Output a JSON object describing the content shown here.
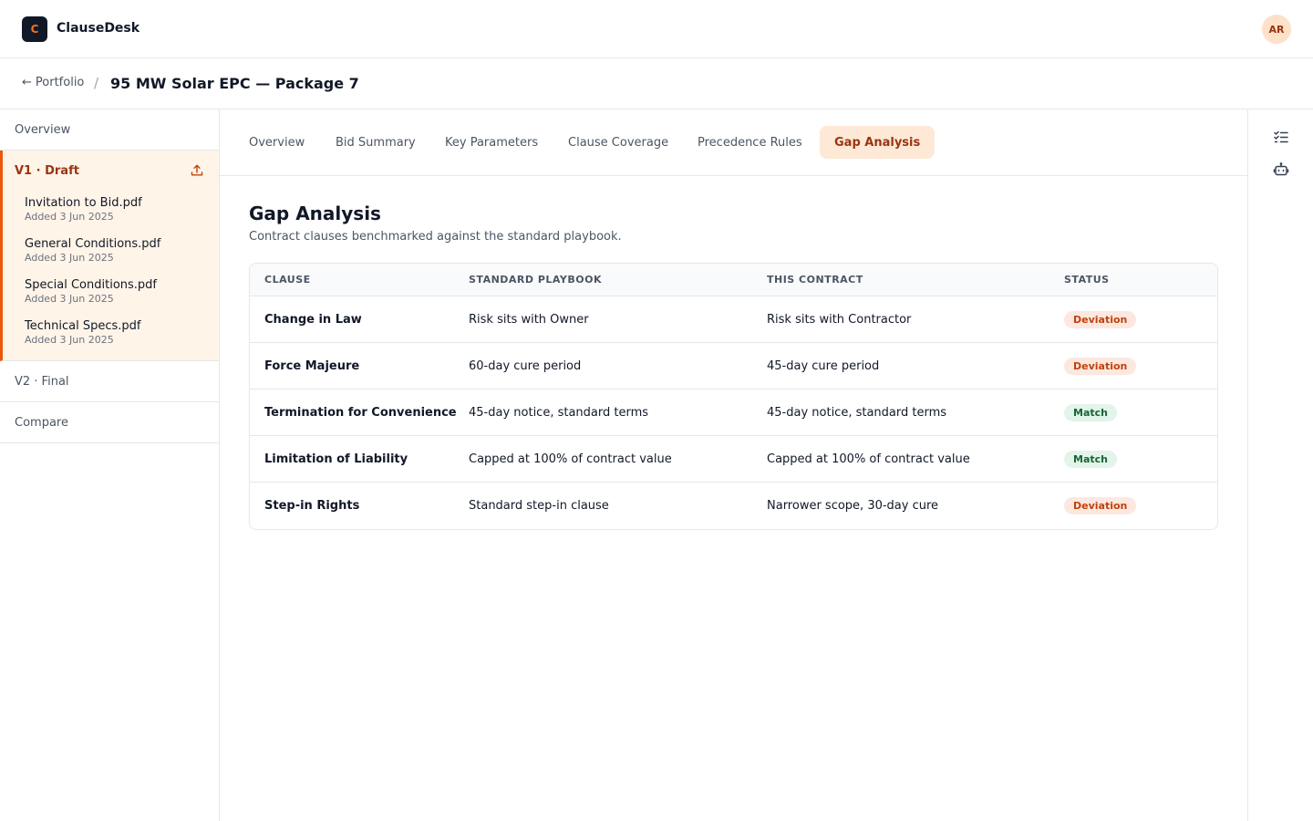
{
  "app": {
    "logo_letter": "C",
    "name": "ClauseDesk",
    "user_initials": "AR"
  },
  "breadcrumb": {
    "back_label": "Portfolio",
    "separator": "/",
    "title": "95 MW Solar EPC — Package 7"
  },
  "sidebar": {
    "overview_label": "Overview",
    "active_version": {
      "label": "V1 · Draft",
      "documents": [
        {
          "name": "Invitation to Bid.pdf",
          "added": "Added 3 Jun 2025"
        },
        {
          "name": "General Conditions.pdf",
          "added": "Added 3 Jun 2025"
        },
        {
          "name": "Special Conditions.pdf",
          "added": "Added 3 Jun 2025"
        },
        {
          "name": "Technical Specs.pdf",
          "added": "Added 3 Jun 2025"
        }
      ]
    },
    "final_version_label": "V2 · Final",
    "compare_label": "Compare"
  },
  "tabs": [
    {
      "label": "Overview"
    },
    {
      "label": "Bid Summary"
    },
    {
      "label": "Key Parameters"
    },
    {
      "label": "Clause Coverage"
    },
    {
      "label": "Precedence Rules"
    },
    {
      "label": "Gap Analysis",
      "active": true
    }
  ],
  "content": {
    "title": "Gap Analysis",
    "subtitle": "Contract clauses benchmarked against the standard playbook.",
    "columns": [
      "CLAUSE",
      "STANDARD PLAYBOOK",
      "THIS CONTRACT",
      "STATUS"
    ],
    "rows": [
      {
        "clause": "Change in Law",
        "standard": "Risk sits with Owner",
        "contract": "Risk sits with Contractor",
        "status": "Deviation"
      },
      {
        "clause": "Force Majeure",
        "standard": "60-day cure period",
        "contract": "45-day cure period",
        "status": "Deviation"
      },
      {
        "clause": "Termination for Convenience",
        "standard": "45-day notice, standard terms",
        "contract": "45-day notice, standard terms",
        "status": "Match"
      },
      {
        "clause": "Limitation of Liability",
        "standard": "Capped at 100% of contract value",
        "contract": "Capped at 100% of contract value",
        "status": "Match"
      },
      {
        "clause": "Step-in Rights",
        "standard": "Standard step-in clause",
        "contract": "Narrower scope, 30-day cure",
        "status": "Deviation"
      }
    ]
  },
  "colors": {
    "accent": "#ea580c",
    "accent_bg": "#fff4e8",
    "deviation": "#c2410c",
    "match": "#166534"
  },
  "icons": {
    "upload": "upload-icon",
    "checklist": "checklist-icon",
    "assistant": "robot-icon",
    "back": "arrow-left-icon"
  }
}
